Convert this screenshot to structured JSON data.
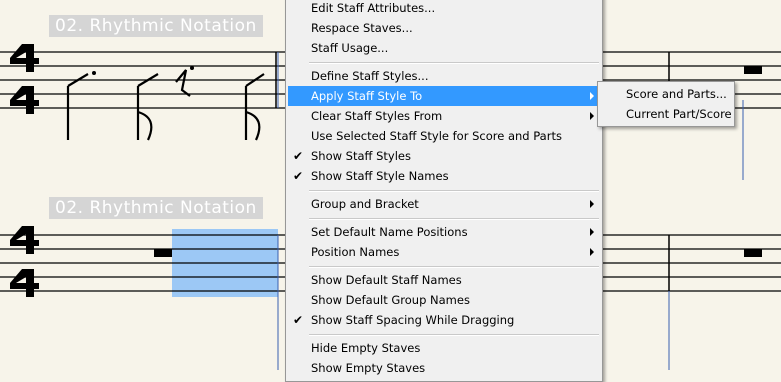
{
  "score": {
    "staff1_label": "02.  Rhythmic Notation",
    "staff2_label": "02.  Rhythmic Notation",
    "time_signature_top": "4",
    "time_signature_bottom": "4"
  },
  "context_menu": {
    "items": [
      {
        "label": "Edit Staff Attributes...",
        "checked": false,
        "submenu": false
      },
      {
        "label": "Respace Staves...",
        "checked": false,
        "submenu": false
      },
      {
        "label": "Staff Usage...",
        "checked": false,
        "submenu": false
      },
      {
        "label": "Define Staff Styles...",
        "checked": false,
        "submenu": false
      },
      {
        "label": "Apply Staff Style To",
        "checked": false,
        "submenu": true,
        "highlighted": true
      },
      {
        "label": "Clear Staff Styles From",
        "checked": false,
        "submenu": true
      },
      {
        "label": "Use Selected Staff Style for Score and Parts",
        "checked": false,
        "submenu": false
      },
      {
        "label": "Show Staff Styles",
        "checked": true,
        "submenu": false
      },
      {
        "label": "Show Staff Style Names",
        "checked": true,
        "submenu": false
      },
      {
        "label": "Group and Bracket",
        "checked": false,
        "submenu": true
      },
      {
        "label": "Set Default Name Positions",
        "checked": false,
        "submenu": true
      },
      {
        "label": "Position Names",
        "checked": false,
        "submenu": true
      },
      {
        "label": "Show Default Staff Names",
        "checked": false,
        "submenu": false
      },
      {
        "label": "Show Default Group Names",
        "checked": false,
        "submenu": false
      },
      {
        "label": "Show Staff Spacing While Dragging",
        "checked": true,
        "submenu": false
      },
      {
        "label": "Hide Empty Staves",
        "checked": false,
        "submenu": false
      },
      {
        "label": "Show Empty Staves",
        "checked": false,
        "submenu": false
      }
    ],
    "check_glyph": "✔"
  },
  "submenu": {
    "items": [
      {
        "label": "Score and Parts..."
      },
      {
        "label": "Current Part/Score"
      }
    ]
  },
  "colors": {
    "highlight": "#3399ff",
    "selection": "#9cc8f5",
    "paper": "#f7f4ea"
  }
}
